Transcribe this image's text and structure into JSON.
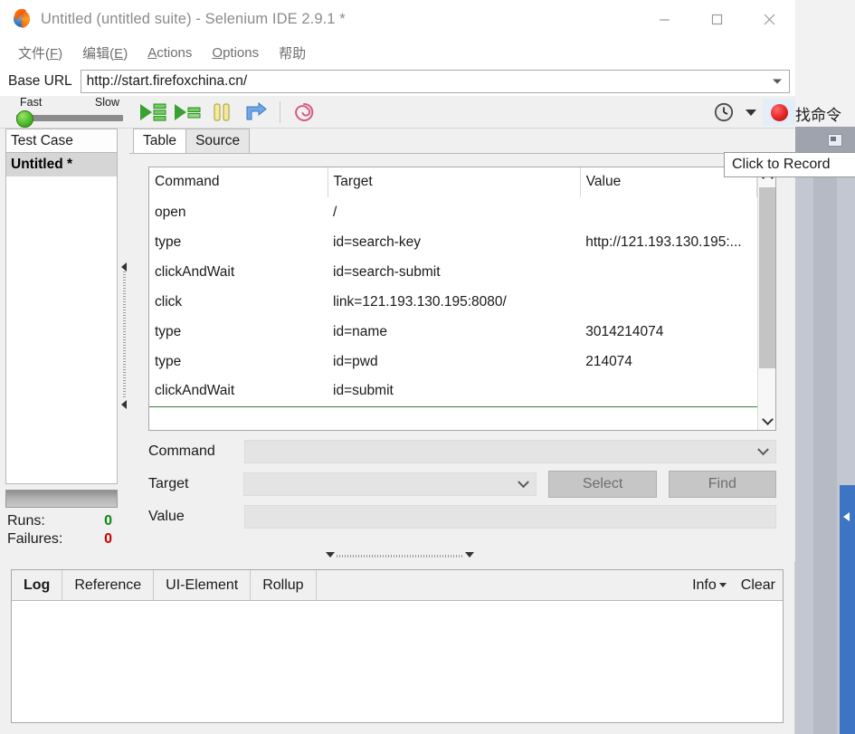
{
  "window": {
    "title": "Untitled (untitled suite) - Selenium IDE 2.9.1 *",
    "app_icon": "firefox-icon",
    "minimize": "minimize-icon",
    "maximize": "maximize-icon",
    "close": "close-icon"
  },
  "menubar": {
    "items": [
      {
        "label": "文件(F)",
        "accel": "F"
      },
      {
        "label": "编辑(E)",
        "accel": "E"
      },
      {
        "label": "Actions",
        "accel": "A"
      },
      {
        "label": "Options",
        "accel": "O"
      },
      {
        "label": "帮助",
        "accel": ""
      }
    ]
  },
  "baseurl": {
    "label": "Base URL",
    "value": "http://start.firefoxchina.cn/",
    "placeholder": ""
  },
  "toolbar": {
    "speed_fast_label": "Fast",
    "speed_slow_label": "Slow",
    "speed_position": "fast",
    "buttons": [
      {
        "name": "play-entire-test-suite-button"
      },
      {
        "name": "play-current-test-case-button"
      },
      {
        "name": "pause-resume-button"
      },
      {
        "name": "step-button"
      },
      {
        "name": "rollup-button"
      }
    ],
    "clock": "clock-icon",
    "dropdown": "chevron-down-icon",
    "record": "record-button",
    "record_label": "找命令"
  },
  "sidebar": {
    "header": "Test Case",
    "items": [
      {
        "label": "Untitled *",
        "selected": true
      }
    ],
    "counters": [
      {
        "label": "Runs:",
        "value": "0",
        "color": "#0b8a0b"
      },
      {
        "label": "Failures:",
        "value": "0",
        "color": "#cc0000"
      }
    ]
  },
  "editor": {
    "tabs": [
      {
        "label": "Table",
        "active": true
      },
      {
        "label": "Source",
        "active": false
      }
    ],
    "table": {
      "columns": [
        "Command",
        "Target",
        "Value"
      ],
      "rows": [
        {
          "command": "open",
          "target": "/",
          "value": ""
        },
        {
          "command": "type",
          "target": "id=search-key",
          "value": "http://121.193.130.195:..."
        },
        {
          "command": "clickAndWait",
          "target": "id=search-submit",
          "value": ""
        },
        {
          "command": "click",
          "target": "link=121.193.130.195:8080/",
          "value": ""
        },
        {
          "command": "type",
          "target": "id=name",
          "value": "3014214074"
        },
        {
          "command": "type",
          "target": "id=pwd",
          "value": "214074"
        },
        {
          "command": "clickAndWait",
          "target": "id=submit",
          "value": ""
        }
      ]
    },
    "form": {
      "command_label": "Command",
      "command_value": "",
      "target_label": "Target",
      "target_value": "",
      "value_label": "Value",
      "value_value": "",
      "select_button": "Select",
      "find_button": "Find"
    }
  },
  "logpanel": {
    "tabs": [
      {
        "label": "Log",
        "active": true
      },
      {
        "label": "Reference",
        "active": false
      },
      {
        "label": "UI-Element",
        "active": false
      },
      {
        "label": "Rollup",
        "active": false
      }
    ],
    "actions": [
      {
        "label": "Info",
        "has_caret": true
      },
      {
        "label": "Clear",
        "has_caret": false
      }
    ],
    "content": ""
  },
  "tooltip": {
    "text": "Click to Record"
  },
  "colors": {
    "accent_green": "#4cbd2a",
    "record_red": "#e02020",
    "runs_green": "#0b8a0b",
    "failures_red": "#cc0000",
    "insert_line_green": "#3a7d3a",
    "background_blue": "#3d74c4"
  }
}
